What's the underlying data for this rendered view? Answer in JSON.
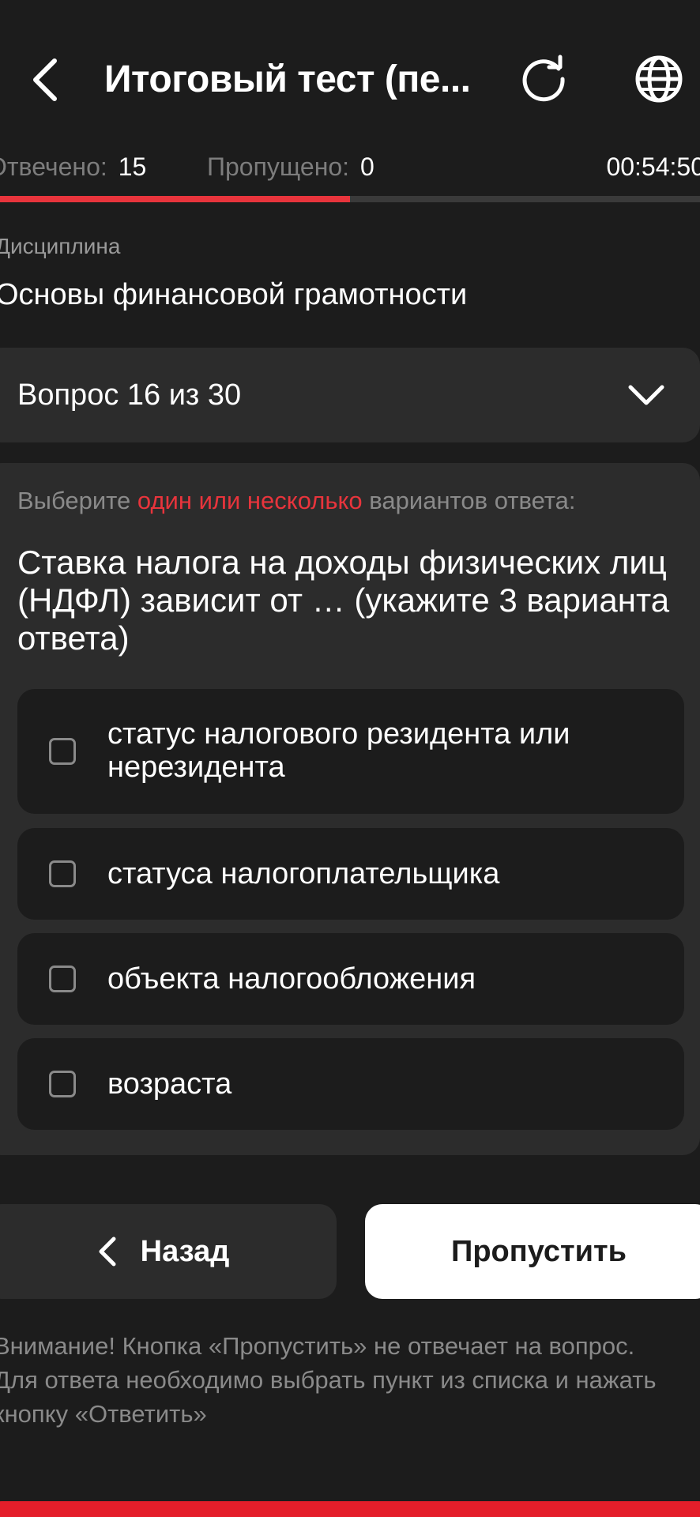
{
  "header": {
    "title": "Итоговый тест (пе..."
  },
  "stats": {
    "answered_label": "Отвечено:",
    "answered_value": "15",
    "skipped_label": "Пропущено:",
    "skipped_value": "0",
    "timer": "00:54:50"
  },
  "progress": {
    "fraction": 0.5
  },
  "discipline": {
    "label": "Дисциплина",
    "name": "Основы финансовой грамотности"
  },
  "question_selector": {
    "label": "Вопрос 16 из 30"
  },
  "question": {
    "instruction_prefix": "Выберите",
    "instruction_accent": "один или несколько",
    "instruction_suffix": "вариантов ответа:",
    "text": "Ставка налога на доходы физических лиц (НДФЛ) зависит от … (укажите 3 варианта ответа)",
    "options": [
      {
        "label": "статус налогового резидента или нерезидента",
        "checked": false
      },
      {
        "label": "статуса налогоплательщика",
        "checked": false
      },
      {
        "label": "объекта налогообложения",
        "checked": false
      },
      {
        "label": "возраста",
        "checked": false
      }
    ]
  },
  "buttons": {
    "back_label": "Назад",
    "skip_label": "Пропустить"
  },
  "notice": "Внимание! Кнопка «Пропустить» не отвечает на вопрос. Для ответа необходимо выбрать пункт из списка и нажать кнопку «Ответить»",
  "colors": {
    "background": "#1c1c1c",
    "surface": "#2c2c2c",
    "accent": "#e8343c",
    "bottom_bar": "#e41e2a"
  }
}
